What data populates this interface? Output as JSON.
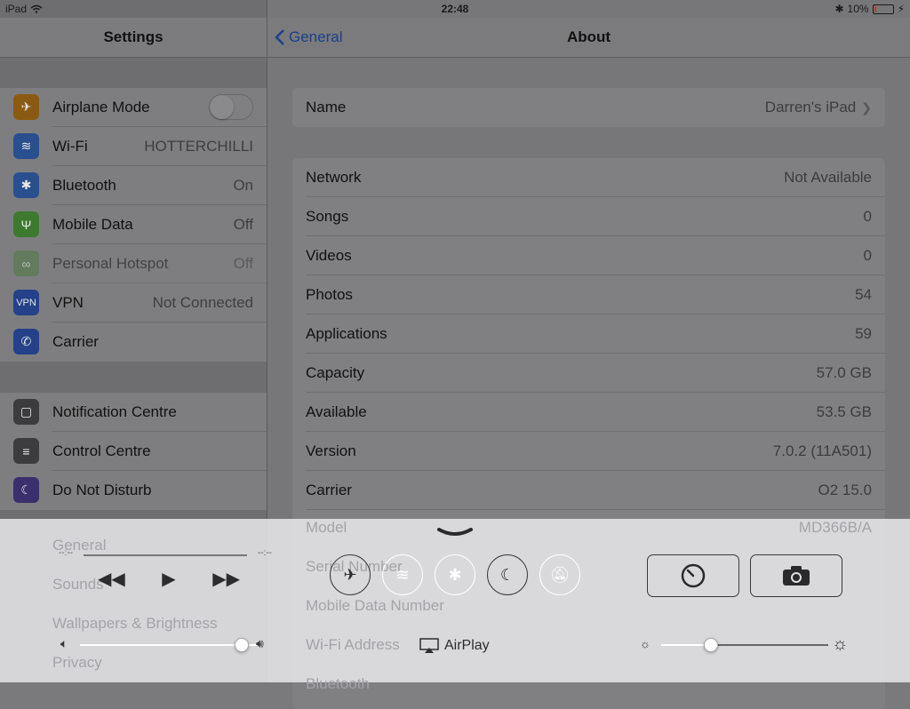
{
  "status_bar": {
    "device": "iPad",
    "time": "22:48",
    "battery": "10%"
  },
  "sidebar": {
    "title": "Settings",
    "group1": [
      {
        "label": "Airplane Mode",
        "value": "",
        "icon": "airplane-icon",
        "color": "#8b5a12"
      },
      {
        "label": "Wi-Fi",
        "value": "HOTTERCHILLI",
        "icon": "wifi-icon",
        "color": "#2a4f8e"
      },
      {
        "label": "Bluetooth",
        "value": "On",
        "icon": "bluetooth-icon",
        "color": "#2a4f8e"
      },
      {
        "label": "Mobile Data",
        "value": "Off",
        "icon": "antenna-icon",
        "color": "#3d7a2f"
      },
      {
        "label": "Personal Hotspot",
        "value": "Off",
        "icon": "hotspot-icon",
        "color": "#4b7a3f"
      },
      {
        "label": "VPN",
        "value": "Not Connected",
        "icon": "vpn-icon",
        "icon_text": "VPN",
        "color": "#24418a"
      },
      {
        "label": "Carrier",
        "value": "",
        "icon": "phone-icon",
        "color": "#24418a"
      }
    ],
    "group2": [
      {
        "label": "Notification Centre",
        "icon": "notification-icon",
        "color": "#3c3c3e"
      },
      {
        "label": "Control Centre",
        "icon": "control-centre-icon",
        "color": "#3c3c3e"
      },
      {
        "label": "Do Not Disturb",
        "icon": "moon-icon",
        "color": "#3b2f6e"
      }
    ],
    "group3_dimmed": [
      {
        "label": "General"
      },
      {
        "label": "Sounds"
      },
      {
        "label": "Wallpapers & Brightness"
      },
      {
        "label": "Privacy"
      }
    ]
  },
  "detail": {
    "back_label": "General",
    "title": "About",
    "name_row": {
      "label": "Name",
      "value": "Darren's iPad"
    },
    "rows": [
      {
        "label": "Network",
        "value": "Not Available"
      },
      {
        "label": "Songs",
        "value": "0"
      },
      {
        "label": "Videos",
        "value": "0"
      },
      {
        "label": "Photos",
        "value": "54"
      },
      {
        "label": "Applications",
        "value": "59"
      },
      {
        "label": "Capacity",
        "value": "57.0 GB"
      },
      {
        "label": "Available",
        "value": "53.5 GB"
      },
      {
        "label": "Version",
        "value": "7.0.2 (11A501)"
      },
      {
        "label": "Carrier",
        "value": "O2 15.0"
      }
    ],
    "dimmed_rows": [
      {
        "label": "Model",
        "value": "MD366B/A"
      },
      {
        "label": "Serial Number",
        "value": ""
      },
      {
        "label": "Mobile Data Number",
        "value": ""
      },
      {
        "label": "Wi-Fi Address",
        "value": ""
      },
      {
        "label": "Bluetooth",
        "value": ""
      }
    ]
  },
  "control_centre": {
    "elapsed": "--:--",
    "remaining": "--:--",
    "airplay_label": "AirPlay",
    "volume_level": 0.91,
    "brightness_level": 0.3,
    "toggles": [
      {
        "name": "airplane-toggle",
        "icon": "airplane-icon",
        "on": false
      },
      {
        "name": "wifi-toggle",
        "icon": "wifi-icon",
        "on": true
      },
      {
        "name": "bluetooth-toggle",
        "icon": "bluetooth-icon",
        "on": true
      },
      {
        "name": "do-not-disturb-toggle",
        "icon": "moon-icon",
        "on": false
      },
      {
        "name": "rotation-lock-toggle",
        "icon": "bell-slash-icon",
        "on": true
      }
    ],
    "quick_buttons": [
      {
        "name": "timer-button",
        "icon": "clock-icon"
      },
      {
        "name": "camera-button",
        "icon": "camera-icon"
      }
    ]
  }
}
